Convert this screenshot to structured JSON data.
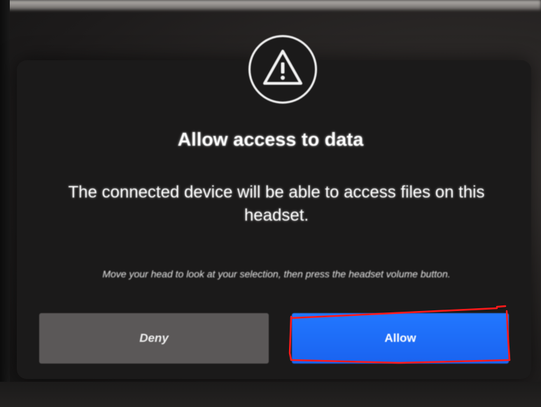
{
  "dialog": {
    "icon": "warning-icon",
    "title": "Allow access to data",
    "body": "The connected device will be able to access files on this headset.",
    "hint": "Move your head to look at your selection, then press the headset volume button.",
    "buttons": {
      "deny_label": "Deny",
      "allow_label": "Allow"
    }
  },
  "colors": {
    "allow_button": "#1e6bff",
    "deny_button": "#5b5858",
    "highlight": "#ff1a1a",
    "dialog_background": "#1b1a1a"
  }
}
